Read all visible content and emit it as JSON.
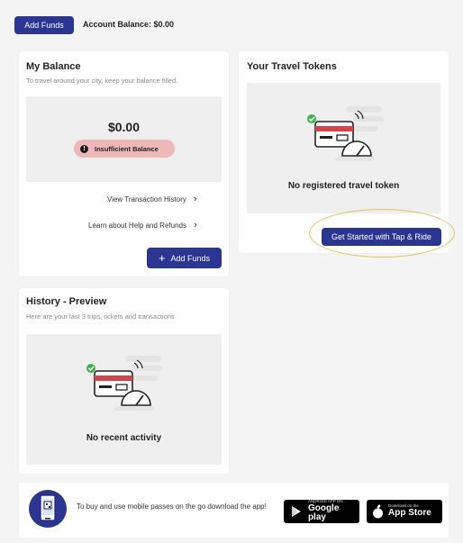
{
  "topbar": {
    "add_funds_label": "Add Funds",
    "account_balance_text": "Account Balance: $0.00"
  },
  "balance_card": {
    "title": "My Balance",
    "subtitle": "To travel around your city, keep your balance filled.",
    "amount": "$0.00",
    "status_badge": "Insufficient Balance",
    "links": [
      "View Transaction History",
      "Learn about Help and Refunds"
    ],
    "add_funds_label": "Add Funds"
  },
  "tokens_card": {
    "title": "Your Travel Tokens",
    "empty_message": "No registered travel token",
    "cta_label": "Get Started with Tap & Ride"
  },
  "history_card": {
    "title": "History - Preview",
    "subtitle": "Here are your last 3 trips, tickets and transactions",
    "empty_message": "No recent activity"
  },
  "footer": {
    "text": "To buy and use mobile passes on the go download the app!",
    "google_play": {
      "small": "ANDROID APP ON",
      "big": "Google play"
    },
    "app_store": {
      "small": "Download on the",
      "big": "App Store"
    }
  },
  "colors": {
    "primary": "#2b3592",
    "badge_bg": "#eeb8b8",
    "highlight": "#e7c35c",
    "check": "#3cb34a",
    "card_red": "#d5444b"
  },
  "icons": [
    "card-with-speedometer-icon",
    "chevron-right-icon",
    "plus-icon",
    "alert-icon",
    "phone-qr-icon",
    "play-icon",
    "apple-icon"
  ]
}
